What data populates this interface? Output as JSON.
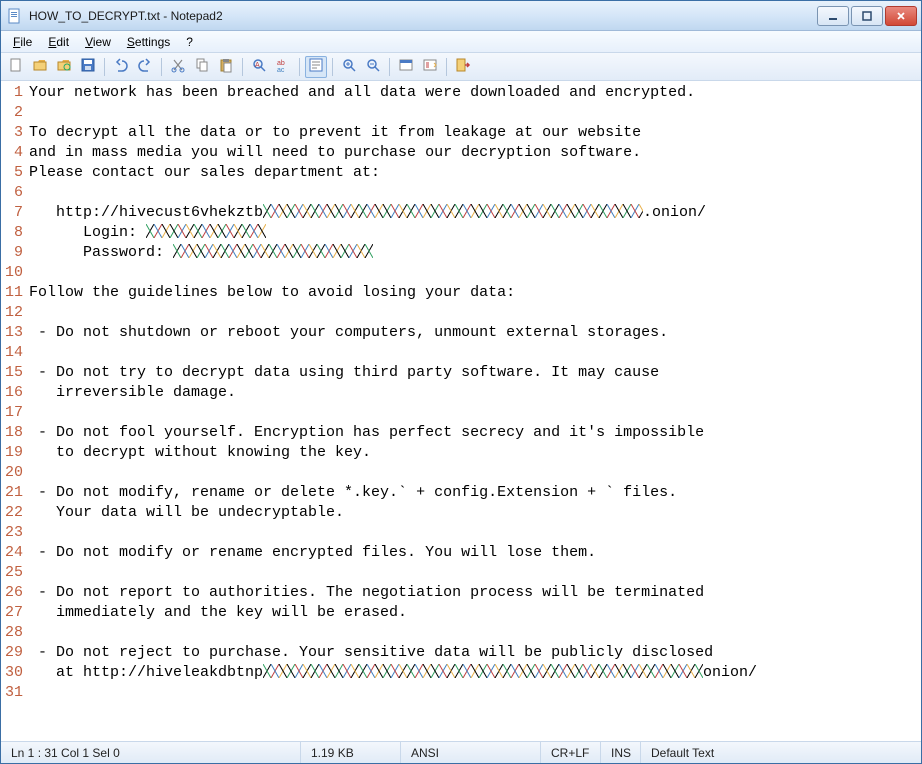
{
  "title": "HOW_TO_DECRYPT.txt - Notepad2",
  "menus": {
    "file": "File",
    "edit": "Edit",
    "view": "View",
    "settings": "Settings",
    "help": "?"
  },
  "lines": [
    "Your network has been breached and all data were downloaded and encrypted.",
    "",
    "To decrypt all the data or to prevent it from leakage at our website",
    "and in mass media you will need to purchase our decryption software.",
    "Please contact our sales department at:",
    "",
    {
      "pre": "   http://hivecust6vhekztb",
      "red": 380,
      "post": ".onion/"
    },
    {
      "pre": "      Login: ",
      "red": 120,
      "post": ""
    },
    {
      "pre": "      Password: ",
      "red": 200,
      "post": ""
    },
    "",
    "Follow the guidelines below to avoid losing your data:",
    "",
    " - Do not shutdown or reboot your computers, unmount external storages.",
    "",
    " - Do not try to decrypt data using third party software. It may cause",
    "   irreversible damage.",
    "",
    " - Do not fool yourself. Encryption has perfect secrecy and it's impossible",
    "   to decrypt without knowing the key.",
    "",
    " - Do not modify, rename or delete *.key.` + config.Extension + ` files.",
    "   Your data will be undecryptable.",
    "",
    " - Do not modify or rename encrypted files. You will lose them.",
    "",
    " - Do not report to authorities. The negotiation process will be terminated",
    "   immediately and the key will be erased.",
    "",
    " - Do not reject to purchase. Your sensitive data will be publicly disclosed",
    {
      "pre": "   at http://hiveleakdbtnp",
      "red": 440,
      "post": "onion/"
    },
    ""
  ],
  "status": {
    "pos": "Ln 1 : 31  Col 1  Sel 0",
    "size": "1.19 KB",
    "encoding": "ANSI",
    "eol": "CR+LF",
    "ins": "INS",
    "syntax": "Default Text"
  },
  "toolbar_icons": [
    "new",
    "open",
    "browse",
    "save",
    "",
    "undo",
    "redo",
    "",
    "cut",
    "copy",
    "paste",
    "",
    "find",
    "replace",
    "",
    "wordwrap",
    "",
    "zoom-in",
    "zoom-out",
    "",
    "scheme",
    "settings",
    "",
    "exit"
  ]
}
